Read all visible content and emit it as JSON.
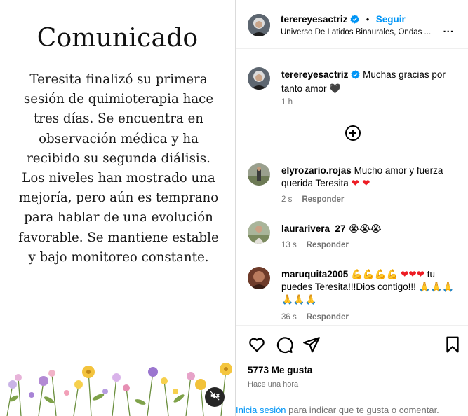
{
  "post": {
    "title": "Comunicado",
    "body": "Teresita finalizó su primera sesión de quimioterapia hace tres días. Se encuentra en observación médica y ha recibido su segunda diálisis. Los niveles han mostrado una mejoría, pero aún es temprano para hablar de una evolución favorable. Se mantiene estable y bajo monitoreo constante.",
    "mute_icon": "speaker-muted-icon"
  },
  "header": {
    "username": "terereyesactriz",
    "separator": "•",
    "follow_label": "Seguir",
    "audio": "Universo De Latidos Binaurales, Ondas ...",
    "more": "..."
  },
  "comments": [
    {
      "username": "terereyesactriz",
      "text": "Muchas gracias por tanto amor",
      "emoji": "🖤",
      "time": "1 h",
      "reply": ""
    },
    {
      "username": "elyrozario.rojas",
      "text": "Mucho amor y fuerza querida Teresita",
      "emoji": "❤ ❤",
      "time": "2 s",
      "reply": "Responder"
    },
    {
      "username": "laurarivera_27",
      "text": "",
      "emoji": "😭😭😭",
      "time": "13 s",
      "reply": "Responder"
    },
    {
      "username": "maruquita2005",
      "text_a": "💪💪💪💪",
      "hearts": "❤❤❤",
      "text_b": "tu puedes Teresita!!!Dios contigo!!!",
      "emoji": "🙏🙏🙏🙏🙏🙏",
      "time": "36 s",
      "reply": "Responder"
    }
  ],
  "actions": {
    "likes": "5773 Me gusta",
    "time_ago": "Hace una hora",
    "login_link": "Inicia sesión",
    "login_rest": " para indicar que te gusta o comentar."
  },
  "colors": {
    "link_blue": "#0095f6",
    "muted_text": "#737373",
    "verified_blue": "#0095f6",
    "heart_red": "#ed1c24"
  }
}
